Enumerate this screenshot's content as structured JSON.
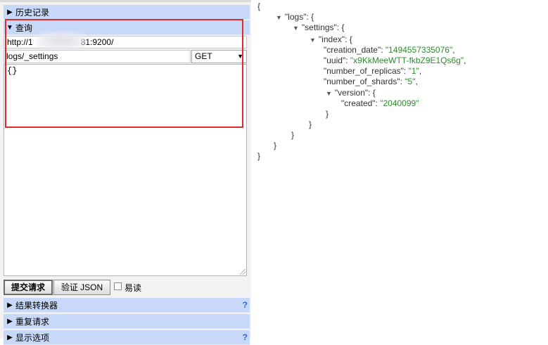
{
  "sections": {
    "history": {
      "label": "历史记录"
    },
    "query": {
      "label": "查询"
    },
    "transform": {
      "label": "结果转换器",
      "help": "?"
    },
    "repeat": {
      "label": "重复请求"
    },
    "display": {
      "label": "显示选项",
      "help": "?"
    }
  },
  "query": {
    "url_visible_start": "http://1",
    "url_visible_end": "81:9200/",
    "path": "logs/_settings",
    "method": "GET",
    "body": "{}"
  },
  "buttons": {
    "submit": "提交请求",
    "validate": "验证 JSON",
    "pretty": "易读"
  },
  "response": {
    "open_brace": "{",
    "close_brace": "}",
    "logs_key": "\"logs\"",
    "settings_key": "\"settings\"",
    "index_key": "\"index\"",
    "creation_date_key": "\"creation_date\"",
    "creation_date_val": "\"1494557335076\"",
    "uuid_key": "\"uuid\"",
    "uuid_val": "\"x9KkMeeWTT-fkbZ9E1Qs6g\"",
    "replicas_key": "\"number_of_replicas\"",
    "replicas_val": "\"1\"",
    "shards_key": "\"number_of_shards\"",
    "shards_val": "\"5\"",
    "version_key": "\"version\"",
    "created_key": "\"created\"",
    "created_val": "\"2040099\""
  },
  "icons": {
    "collapse": "triangle-down-icon",
    "expand": "triangle-right-icon"
  }
}
